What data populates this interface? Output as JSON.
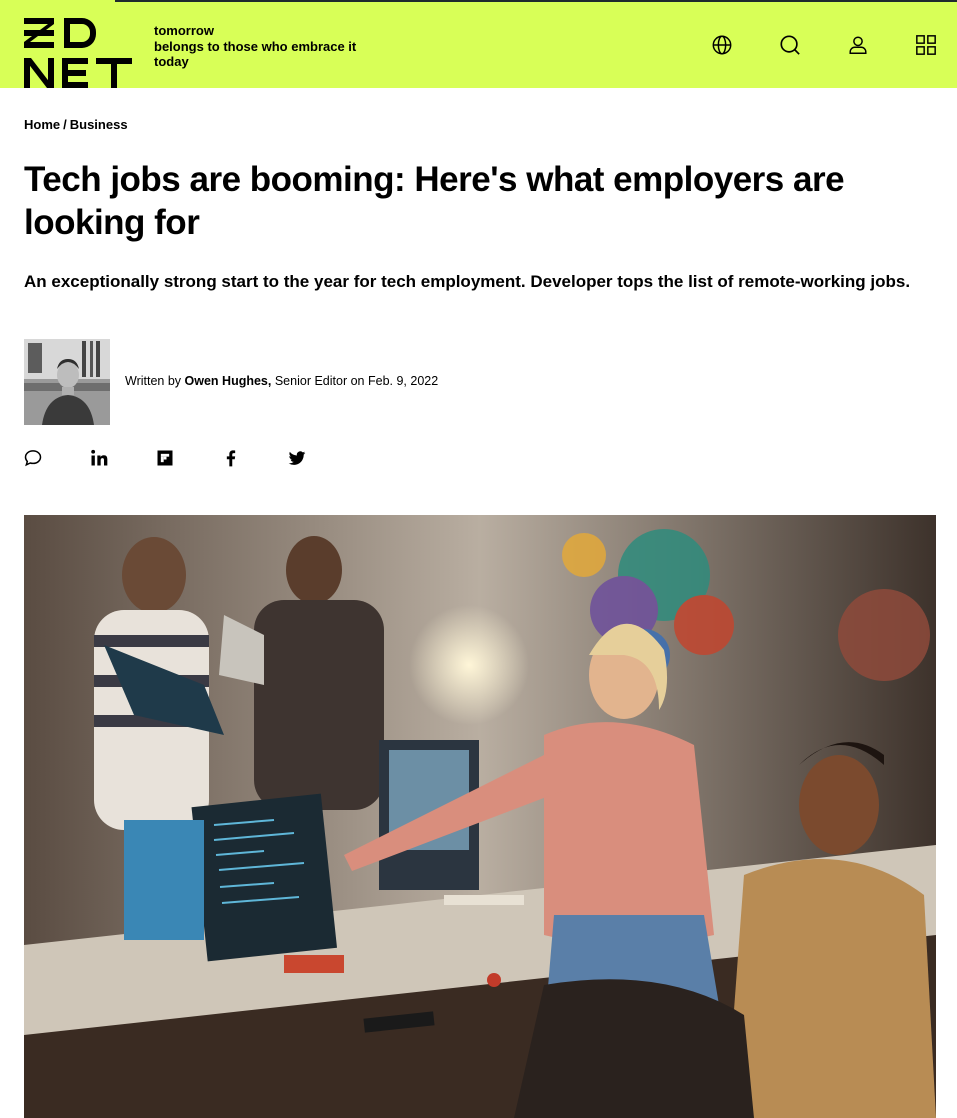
{
  "header": {
    "logo_text": "ZDNET",
    "tagline": [
      "tomorrow",
      "belongs to those who embrace it",
      "today"
    ],
    "icons": [
      "globe-icon",
      "search-icon",
      "user-icon",
      "grid-menu-icon"
    ],
    "accent_color": "#d8ff57"
  },
  "breadcrumb": {
    "home": "Home",
    "separator": "/",
    "section": "Business"
  },
  "article": {
    "title": "Tech jobs are booming: Here's what employers are looking for",
    "subtitle": "An exceptionally strong start to the year for tech employment. Developer tops the list of remote-working jobs.",
    "byline": {
      "written_by": "Written by",
      "author": "Owen Hughes,",
      "role": "Senior Editor",
      "date_prefix": "on",
      "date": "Feb. 9, 2022"
    }
  },
  "share": {
    "icons": [
      "comment-icon",
      "linkedin-icon",
      "flipboard-icon",
      "facebook-icon",
      "twitter-icon"
    ]
  },
  "hero_image": {
    "description_icon": "office-team-photo"
  }
}
